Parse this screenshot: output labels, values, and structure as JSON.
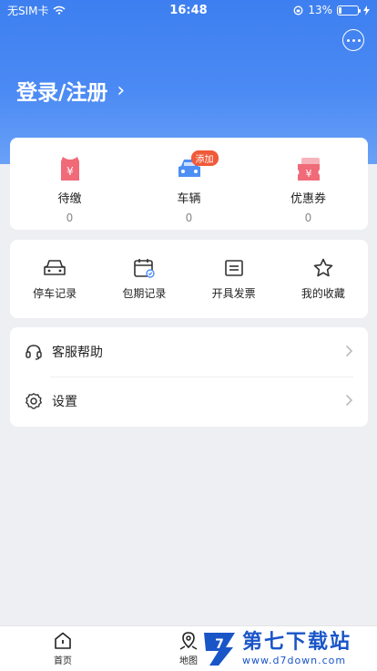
{
  "status_bar": {
    "carrier": "无SIM卡",
    "time": "16:48",
    "battery_percent_label": "13%",
    "battery_level": 0.13,
    "icons": [
      "wifi-icon",
      "orientation-lock-icon",
      "battery-icon",
      "charging-icon"
    ]
  },
  "header": {
    "login_label": "登录/注册",
    "chevron": "›"
  },
  "wallet": [
    {
      "label": "待缴",
      "value": "0",
      "icon": "pending-payment-icon"
    },
    {
      "label": "车辆",
      "value": "0",
      "icon": "car-icon",
      "badge": "添加"
    },
    {
      "label": "优惠券",
      "value": "0",
      "icon": "coupon-icon"
    }
  ],
  "quick_actions": [
    {
      "label": "停车记录",
      "icon": "car-outline-icon"
    },
    {
      "label": "包期记录",
      "icon": "calendar-icon"
    },
    {
      "label": "开具发票",
      "icon": "invoice-icon"
    },
    {
      "label": "我的收藏",
      "icon": "star-icon"
    }
  ],
  "menu": [
    {
      "label": "客服帮助",
      "icon": "headset-icon"
    },
    {
      "label": "设置",
      "icon": "gear-icon"
    }
  ],
  "tabbar": [
    {
      "label": "首页",
      "icon": "home-icon"
    },
    {
      "label": "地图",
      "icon": "map-icon"
    }
  ],
  "watermark": {
    "title": "第七下载站",
    "url": "www.d7down.com"
  },
  "colors": {
    "header_blue": "#3d7ff0",
    "badge_red": "#f05a3a",
    "icon_pink": "#f06a78",
    "watermark_blue": "#1a55c8"
  }
}
